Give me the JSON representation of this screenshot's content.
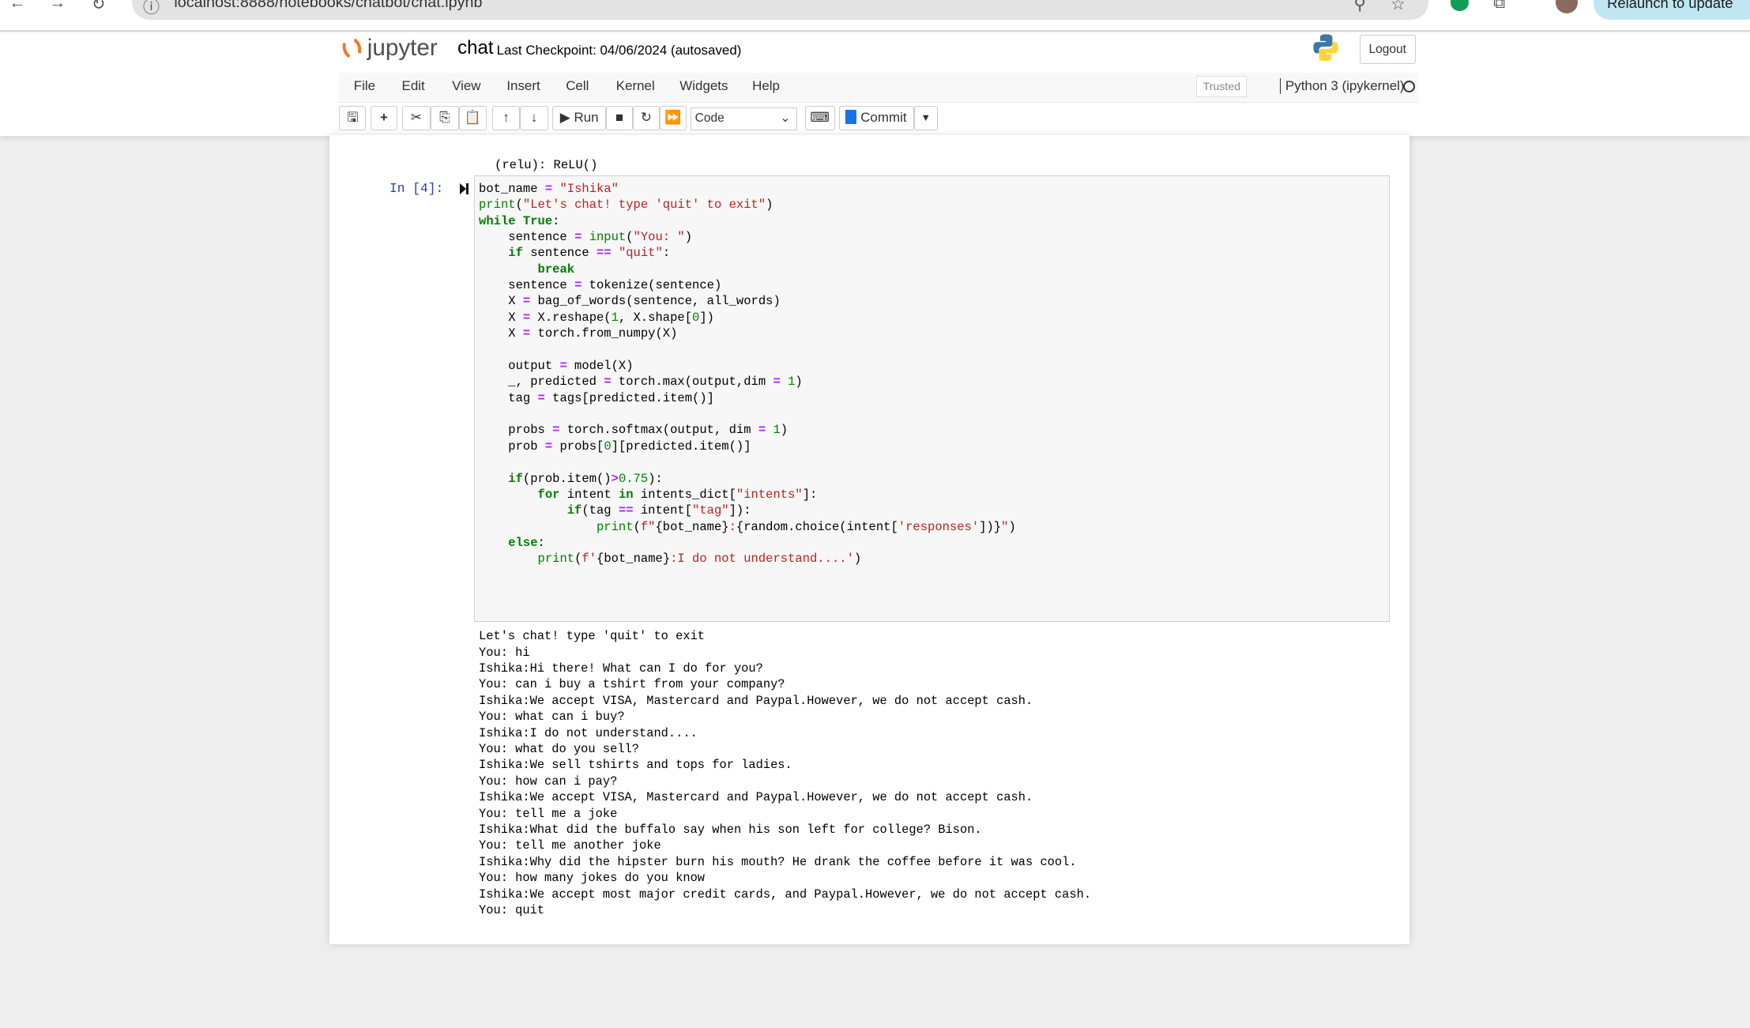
{
  "browser": {
    "url": "localhost:8888/notebooks/chatbot/chat.ipynb",
    "relaunch_label": "Relaunch to update"
  },
  "header": {
    "logo_text": "jupyter",
    "notebook_name": "chat",
    "checkpoint": "Last Checkpoint: 04/06/2024  (autosaved)",
    "logout_label": "Logout"
  },
  "menu": {
    "items": [
      "File",
      "Edit",
      "View",
      "Insert",
      "Cell",
      "Kernel",
      "Widgets",
      "Help"
    ],
    "trusted": "Trusted",
    "kernel": "Python 3 (ipykernel)"
  },
  "toolbar": {
    "run_label": "Run",
    "cell_type": "Code",
    "commit_label": "Commit"
  },
  "previous_cell": {
    "lines": [
      "  (relu): ReLU()",
      ")"
    ]
  },
  "cell": {
    "prompt": "In [4]:",
    "code": [
      [
        [
          "bot_name ",
          ""
        ],
        [
          "=",
          "o"
        ],
        [
          " ",
          ""
        ],
        [
          "\"Ishika\"",
          "s"
        ]
      ],
      [
        [
          "print",
          "b"
        ],
        [
          "(",
          ""
        ],
        [
          "\"Let's chat! type 'quit' to exit\"",
          "s"
        ],
        [
          ")",
          ""
        ]
      ],
      [
        [
          "while",
          "k"
        ],
        [
          " ",
          ""
        ],
        [
          "True",
          "k"
        ],
        [
          ":",
          ""
        ]
      ],
      [
        [
          "    sentence ",
          ""
        ],
        [
          "=",
          "o"
        ],
        [
          " ",
          ""
        ],
        [
          "input",
          "b"
        ],
        [
          "(",
          ""
        ],
        [
          "\"You: \"",
          "s"
        ],
        [
          ")",
          ""
        ]
      ],
      [
        [
          "    ",
          ""
        ],
        [
          "if",
          "k"
        ],
        [
          " sentence ",
          ""
        ],
        [
          "==",
          "o"
        ],
        [
          " ",
          ""
        ],
        [
          "\"quit\"",
          "s"
        ],
        [
          ":",
          ""
        ]
      ],
      [
        [
          "        ",
          ""
        ],
        [
          "break",
          "k"
        ]
      ],
      [
        [
          "    sentence ",
          ""
        ],
        [
          "=",
          "o"
        ],
        [
          " tokenize(sentence)",
          ""
        ]
      ],
      [
        [
          "    X ",
          ""
        ],
        [
          "=",
          "o"
        ],
        [
          " bag_of_words(sentence, all_words)",
          ""
        ]
      ],
      [
        [
          "    X ",
          ""
        ],
        [
          "=",
          "o"
        ],
        [
          " X.reshape(",
          ""
        ],
        [
          "1",
          "n"
        ],
        [
          ", X.shape[",
          ""
        ],
        [
          "0",
          "n"
        ],
        [
          "])",
          ""
        ]
      ],
      [
        [
          "    X ",
          ""
        ],
        [
          "=",
          "o"
        ],
        [
          " torch.from_numpy(X)",
          ""
        ]
      ],
      [
        [
          "",
          ""
        ]
      ],
      [
        [
          "    output ",
          ""
        ],
        [
          "=",
          "o"
        ],
        [
          " model(X)",
          ""
        ]
      ],
      [
        [
          "    _, predicted ",
          ""
        ],
        [
          "=",
          "o"
        ],
        [
          " torch.max(output,dim ",
          ""
        ],
        [
          "=",
          "o"
        ],
        [
          " ",
          ""
        ],
        [
          "1",
          "n"
        ],
        [
          ")",
          ""
        ]
      ],
      [
        [
          "    tag ",
          ""
        ],
        [
          "=",
          "o"
        ],
        [
          " tags[predicted.item()]",
          ""
        ]
      ],
      [
        [
          "",
          ""
        ]
      ],
      [
        [
          "    probs ",
          ""
        ],
        [
          "=",
          "o"
        ],
        [
          " torch.softmax(output, dim ",
          ""
        ],
        [
          "=",
          "o"
        ],
        [
          " ",
          ""
        ],
        [
          "1",
          "n"
        ],
        [
          ")",
          ""
        ]
      ],
      [
        [
          "    prob ",
          ""
        ],
        [
          "=",
          "o"
        ],
        [
          " probs[",
          ""
        ],
        [
          "0",
          "n"
        ],
        [
          "][predicted.item()]",
          ""
        ]
      ],
      [
        [
          "",
          ""
        ]
      ],
      [
        [
          "    ",
          ""
        ],
        [
          "if",
          "k"
        ],
        [
          "(prob.item()",
          ""
        ],
        [
          ">",
          "o"
        ],
        [
          "0.75",
          "n"
        ],
        [
          "):",
          ""
        ]
      ],
      [
        [
          "        ",
          ""
        ],
        [
          "for",
          "k"
        ],
        [
          " intent ",
          ""
        ],
        [
          "in",
          "k"
        ],
        [
          " intents_dict[",
          ""
        ],
        [
          "\"intents\"",
          "s"
        ],
        [
          "]:",
          ""
        ]
      ],
      [
        [
          "            ",
          ""
        ],
        [
          "if",
          "k"
        ],
        [
          "(tag ",
          ""
        ],
        [
          "==",
          "o"
        ],
        [
          " intent[",
          ""
        ],
        [
          "\"tag\"",
          "s"
        ],
        [
          "]):",
          ""
        ]
      ],
      [
        [
          "                ",
          ""
        ],
        [
          "print",
          "b"
        ],
        [
          "(",
          ""
        ],
        [
          "f\"",
          "s"
        ],
        [
          "{bot_name}",
          ""
        ],
        [
          ":",
          "s"
        ],
        [
          "{random.choice(intent[",
          ""
        ],
        [
          "'responses'",
          "s"
        ],
        [
          "])}",
          ""
        ],
        [
          "\"",
          "s"
        ],
        [
          ")",
          ""
        ]
      ],
      [
        [
          "    ",
          ""
        ],
        [
          "else",
          "k"
        ],
        [
          ":",
          ""
        ]
      ],
      [
        [
          "        ",
          ""
        ],
        [
          "print",
          "b"
        ],
        [
          "(",
          ""
        ],
        [
          "f'",
          "s"
        ],
        [
          "{bot_name}",
          ""
        ],
        [
          ":I do not understand....'",
          "s"
        ],
        [
          ")",
          ""
        ]
      ]
    ],
    "output": [
      "Let's chat! type 'quit' to exit",
      "You: hi",
      "Ishika:Hi there! What can I do for you?",
      "You: can i buy a tshirt from your company?",
      "Ishika:We accept VISA, Mastercard and Paypal.However, we do not accept cash.",
      "You: what can i buy?",
      "Ishika:I do not understand....",
      "You: what do you sell?",
      "Ishika:We sell tshirts and tops for ladies.",
      "You: how can i pay?",
      "Ishika:We accept VISA, Mastercard and Paypal.However, we do not accept cash.",
      "You: tell me a joke",
      "Ishika:What did the buffalo say when his son left for college? Bison.",
      "You: tell me another joke",
      "Ishika:Why did the hipster burn his mouth? He drank the coffee before it was cool.",
      "You: how many jokes do you know",
      "Ishika:We accept most major credit cards, and Paypal.However, we do not accept cash.",
      "You: quit"
    ]
  },
  "colors": {
    "jupyter_orange": "#f37726",
    "prompt_blue": "#303f9f",
    "keyword_green": "#008000",
    "string_red": "#ba2121",
    "operator_purple": "#aa22ff",
    "commit_blue": "#1a73e8"
  }
}
